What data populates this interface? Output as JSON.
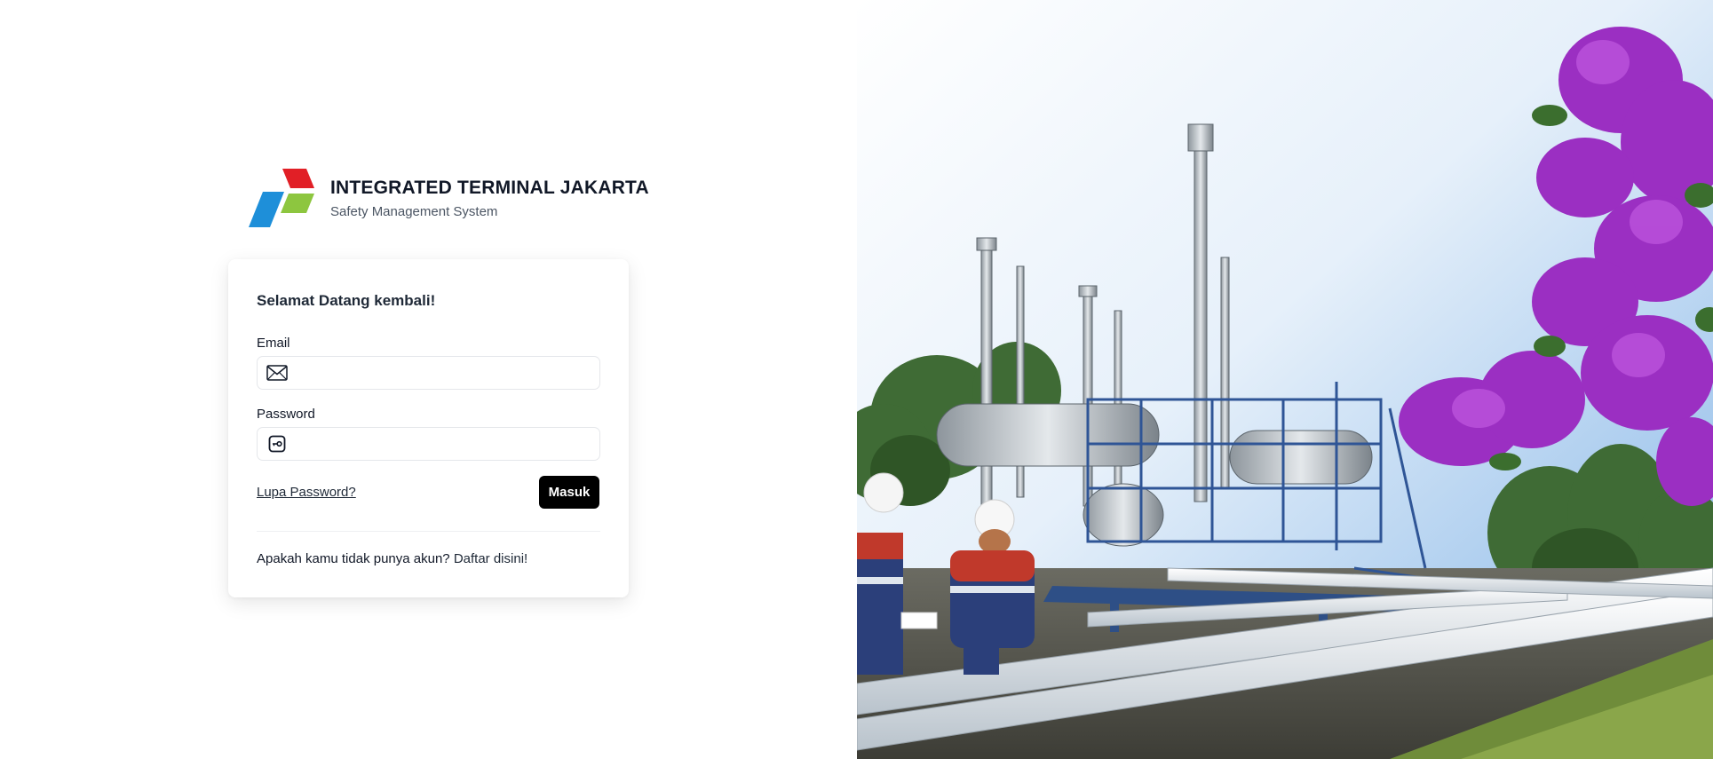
{
  "brand": {
    "title": "INTEGRATED TERMINAL JAKARTA",
    "subtitle": "Safety Management System",
    "logo_icon": "pertamina-logo-icon",
    "logo_colors": [
      "#E11F26",
      "#8DC63F",
      "#1E8FD9"
    ]
  },
  "login": {
    "heading": "Selamat Datang kembali!",
    "email_label": "Email",
    "email_value": "",
    "email_icon": "envelope-icon",
    "password_label": "Password",
    "password_value": "",
    "password_icon": "key-icon",
    "forgot_label": "Lupa Password?",
    "submit_label": "Masuk",
    "signup_prompt": "Apakah kamu tidak punya akun?",
    "signup_link": "Daftar disini!"
  },
  "hero": {
    "image_description_icon": "industrial-terminal-photo",
    "accent_colors": [
      "#2f5596",
      "#c0392b",
      "#9b2fc2"
    ]
  }
}
